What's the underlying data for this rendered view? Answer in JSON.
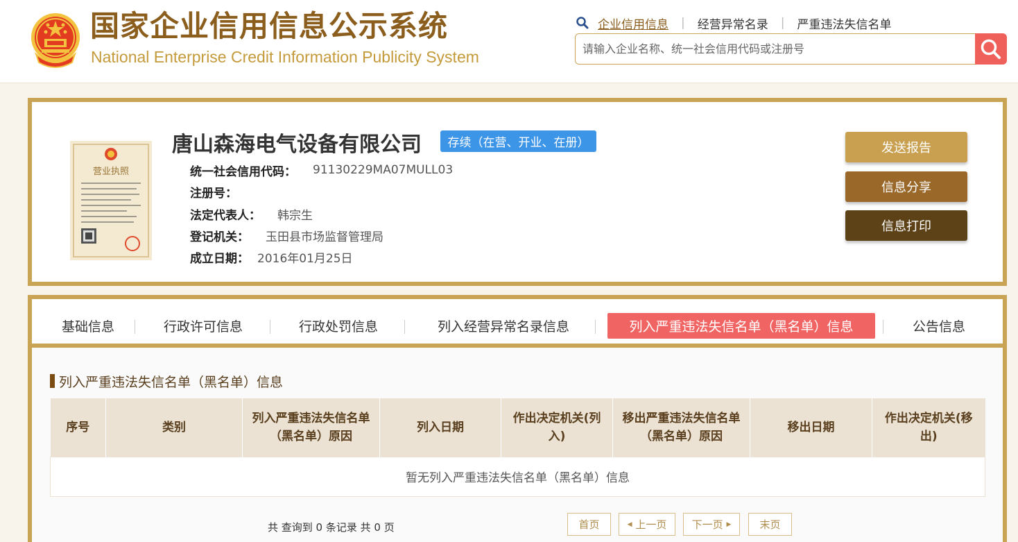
{
  "header": {
    "title": "国家企业信用信息公示系统",
    "subtitle": "National Enterprise Credit Information Publicity System",
    "links": [
      "企业信用信息",
      "经营异常名录",
      "严重违法失信名单"
    ],
    "search_placeholder": "请输入企业名称、统一社会信用代码或注册号",
    "icons": {
      "link_icon": "search-icon",
      "search_button_icon": "search-icon",
      "logo": "national-emblem-icon"
    }
  },
  "company": {
    "name": "唐山森海电气设备有限公司",
    "status": "存续（在营、开业、在册）",
    "fields": [
      {
        "label": "统一社会信用代码：",
        "value": "91130229MA07MULL03"
      },
      {
        "label": "注册号：",
        "value": ""
      },
      {
        "label": "法定代表人：",
        "value": "韩宗生"
      },
      {
        "label": "登记机关：",
        "value": "玉田县市场监督管理局"
      },
      {
        "label": "成立日期：",
        "value": "2016年01月25日"
      }
    ],
    "license_icon": "business-license-icon",
    "license_heading": "营业执照",
    "actions": [
      "发送报告",
      "信息分享",
      "信息打印"
    ]
  },
  "tabs": {
    "items": [
      "基础信息",
      "行政许可信息",
      "行政处罚信息",
      "列入经营异常名录信息",
      "列入严重违法失信名单（黑名单）信息",
      "公告信息"
    ],
    "active_index": 4
  },
  "section": {
    "title": "列入严重违法失信名单（黑名单）信息",
    "table": {
      "columns": [
        "序号",
        "类别",
        "列入严重违法失信名单（黑名单）原因",
        "列入日期",
        "作出决定机关(列入)",
        "移出严重违法失信名单（黑名单）原因",
        "移出日期",
        "作出决定机关(移出)"
      ],
      "empty_text": "暂无列入严重违法失信名单（黑名单）信息"
    }
  },
  "pagination": {
    "summary": "共 查询到 0 条记录 共 0 页",
    "first": "首页",
    "prev": "上一页",
    "next": "下一页",
    "last": "末页"
  },
  "colors": {
    "brand_gold": "#c9a454",
    "brand_brown": "#8b5e1e",
    "accent_red": "#f06563",
    "status_blue": "#3d95e8",
    "action_send": "#c9a050",
    "action_share": "#9a6829",
    "action_print": "#5e4217"
  }
}
